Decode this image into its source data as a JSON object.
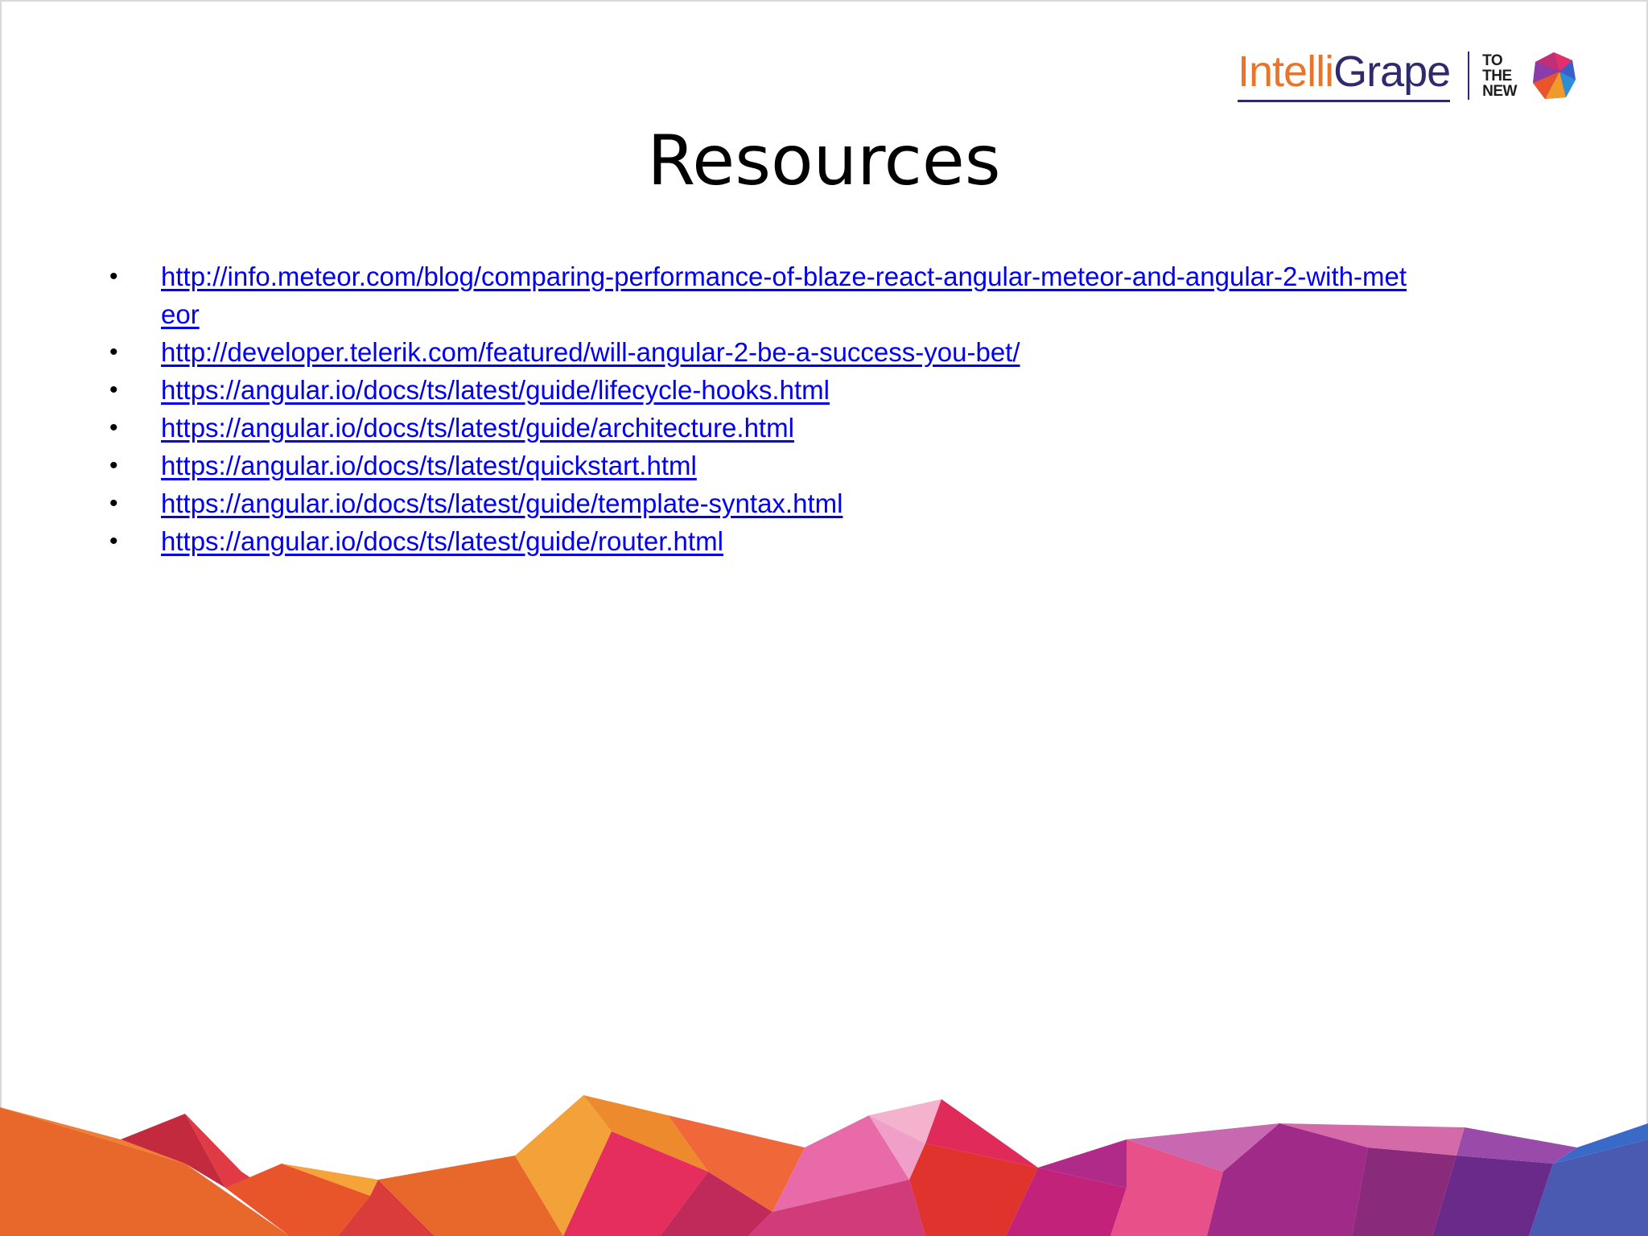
{
  "logo": {
    "word_part1": "Intelli",
    "word_part2": "Grape",
    "tothenew_lines": [
      "TO",
      "THE",
      "NEW"
    ]
  },
  "title": "Resources",
  "links": [
    "http://info.meteor.com/blog/comparing-performance-of-blaze-react-angular-meteor-and-angular-2-with-meteor",
    "http://developer.telerik.com/featured/will-angular-2-be-a-success-you-bet/",
    "https://angular.io/docs/ts/latest/guide/lifecycle-hooks.html",
    "https://angular.io/docs/ts/latest/guide/architecture.html",
    "https://angular.io/docs/ts/latest/quickstart.html",
    "https://angular.io/docs/ts/latest/guide/template-syntax.html",
    "https://angular.io/docs/ts/latest/guide/router.html"
  ],
  "bullet_glyph": "•",
  "colors": {
    "link": "#0000ee",
    "brand_orange": "#e8752a",
    "brand_navy": "#2e2a6b"
  }
}
